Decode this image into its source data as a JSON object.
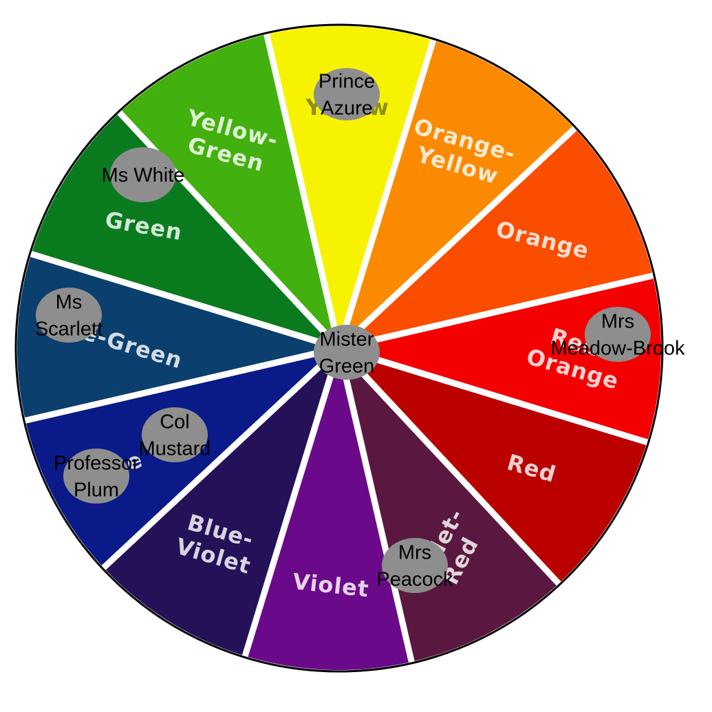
{
  "segments": [
    {
      "id": "yellow",
      "lines": [
        "Yellow"
      ],
      "color": "#f7f200",
      "dark": true
    },
    {
      "id": "orange-yellow",
      "lines": [
        "Orange-",
        "Yellow"
      ],
      "color": "#fb8a00"
    },
    {
      "id": "orange",
      "lines": [
        "Orange"
      ],
      "color": "#fb4d00"
    },
    {
      "id": "red-orange",
      "lines": [
        "Red-",
        "Orange"
      ],
      "color": "#f40000"
    },
    {
      "id": "red",
      "lines": [
        "Red"
      ],
      "color": "#bb0000"
    },
    {
      "id": "violet-red",
      "lines": [
        "Violet-",
        "Red"
      ],
      "color": "#5a1840"
    },
    {
      "id": "violet",
      "lines": [
        "Violet"
      ],
      "color": "#6a0a8a"
    },
    {
      "id": "blue-violet",
      "lines": [
        "Blue-",
        "Violet"
      ],
      "color": "#241158"
    },
    {
      "id": "blue",
      "lines": [
        "Blue"
      ],
      "color": "#0a1a88"
    },
    {
      "id": "blue-green",
      "lines": [
        "Blue-Green"
      ],
      "color": "#0b3f6e"
    },
    {
      "id": "green",
      "lines": [
        "Green"
      ],
      "color": "#0a7a1e"
    },
    {
      "id": "yellow-green",
      "lines": [
        "Yellow-",
        "Green"
      ],
      "color": "#42b00e"
    }
  ],
  "characters": [
    {
      "id": "prince-azure",
      "lines": [
        "Prince",
        "Azure"
      ]
    },
    {
      "id": "ms-white",
      "lines": [
        "Ms White"
      ]
    },
    {
      "id": "ms-scarlett",
      "lines": [
        "Ms",
        "Scarlett"
      ]
    },
    {
      "id": "col-mustard",
      "lines": [
        "Col",
        "Mustard"
      ]
    },
    {
      "id": "professor-plum",
      "lines": [
        "Professor",
        "Plum"
      ]
    },
    {
      "id": "mister-green",
      "lines": [
        "Mister",
        "Green"
      ]
    },
    {
      "id": "mrs-meadow-brook",
      "lines": [
        "Mrs",
        "Meadow-Brook"
      ]
    },
    {
      "id": "mrs-peacock",
      "lines": [
        "Mrs",
        "Peacock"
      ]
    }
  ]
}
